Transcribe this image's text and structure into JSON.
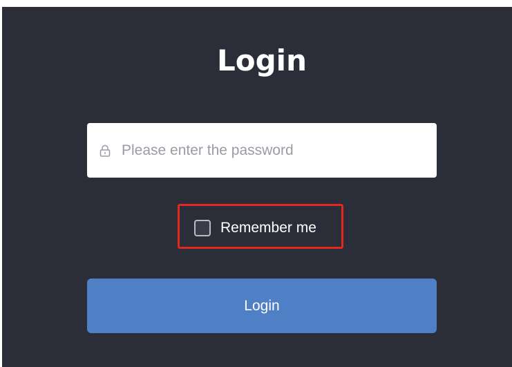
{
  "login": {
    "title": "Login",
    "password": {
      "placeholder": "Please enter the password",
      "value": "",
      "icon": "lock-icon"
    },
    "remember_me": {
      "label": "Remember me",
      "checked": false
    },
    "submit_label": "Login"
  },
  "colors": {
    "background": "#2b2d38",
    "button": "#4f7fc4",
    "highlight": "#e5281e"
  }
}
